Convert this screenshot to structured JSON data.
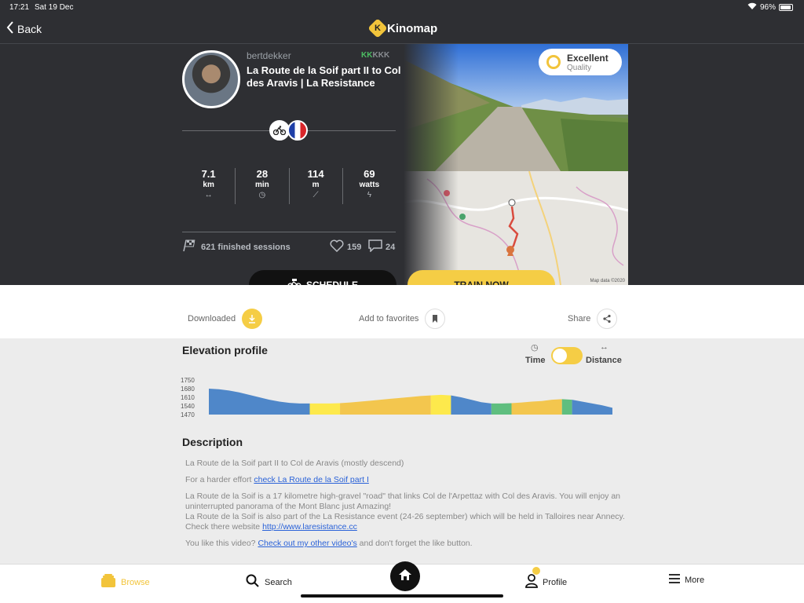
{
  "status": {
    "time": "17:21",
    "date": "Sat 19 Dec",
    "battery": "96%",
    "battery_level": 0.96
  },
  "nav": {
    "back_label": "Back",
    "brand": "Kinomap"
  },
  "video": {
    "author": "bertdekker",
    "rating_icons": [
      "green",
      "green",
      "gray",
      "gray",
      "gray"
    ],
    "title": "La Route de la Soif part II to Col des Aravis | La Resistance",
    "stats": [
      {
        "value": "7.1",
        "unit": "km",
        "icon": "↔"
      },
      {
        "value": "28",
        "unit": "min",
        "icon": "◷"
      },
      {
        "value": "114",
        "unit": "m",
        "icon": "⟋"
      },
      {
        "value": "69",
        "unit": "watts",
        "icon": "ϟ"
      }
    ],
    "finished_sessions": "621 finished sessions",
    "likes": "159",
    "comments": "24",
    "quality_title": "Excellent",
    "quality_sub": "Quality",
    "map_credit": "Map data ©2020"
  },
  "buttons": {
    "schedule": "SCHEDULE",
    "train_now": "TRAIN NOW"
  },
  "actions": {
    "downloaded": "Downloaded",
    "favorites": "Add to favorites",
    "share": "Share"
  },
  "elevation": {
    "title": "Elevation profile",
    "toggle_left": "Time",
    "toggle_right": "Distance",
    "y_ticks": [
      "1750",
      "1680",
      "1610",
      "1540",
      "1470"
    ]
  },
  "chart_data": {
    "type": "area",
    "ylim": [
      1470,
      1750
    ],
    "y": [
      1680,
      1675,
      1665,
      1650,
      1630,
      1610,
      1590,
      1575,
      1565,
      1560,
      1560,
      1560,
      1560,
      1562,
      1568,
      1575,
      1582,
      1590,
      1598,
      1605,
      1612,
      1620,
      1625,
      1630,
      1625,
      1610,
      1590,
      1570,
      1560,
      1560,
      1562,
      1568,
      1575,
      1580,
      1590,
      1595,
      1590,
      1575,
      1560,
      1545,
      1525
    ],
    "segments": [
      {
        "from": 0,
        "to": 10,
        "color": "#4f87c9"
      },
      {
        "from": 10,
        "to": 13,
        "color": "#fde94c"
      },
      {
        "from": 13,
        "to": 22,
        "color": "#f3c64e"
      },
      {
        "from": 22,
        "to": 24,
        "color": "#fde94c"
      },
      {
        "from": 24,
        "to": 28,
        "color": "#4f87c9"
      },
      {
        "from": 28,
        "to": 30,
        "color": "#5fbe7f"
      },
      {
        "from": 30,
        "to": 35,
        "color": "#f3c64e"
      },
      {
        "from": 35,
        "to": 36,
        "color": "#5fbe7f"
      },
      {
        "from": 36,
        "to": 40,
        "color": "#4f87c9"
      }
    ]
  },
  "description": {
    "title": "Description",
    "line1": "La Route de la Soif part II to Col de Aravis (mostly descend)",
    "line2_pre": "For a harder effort ",
    "line2_link": "check La Route de la Soif part I",
    "para3": "La Route de la Soif is a 17 kilometre high-gravel \"road\" that links Col de l'Arpettaz with Col des Aravis. You will enjoy an uninterrupted panorama of the Mont Blanc just Amazing!",
    "para4": "La Route de la Soif is also part of the La Resistance event (24-26 september) which will be held in Talloires near Annecy. Check there website ",
    "para4_link": "http://www.laresistance.cc ",
    "line5_pre": "You like this video? ",
    "line5_link": "Check out my other video's",
    "line5_post": " and don't forget the like button."
  },
  "tabs": {
    "browse": "Browse",
    "search": "Search",
    "profile": "Profile",
    "more": "More"
  },
  "colors": {
    "accent": "#f5cd45",
    "dark": "#2e2f33",
    "link": "#2a62d8"
  }
}
